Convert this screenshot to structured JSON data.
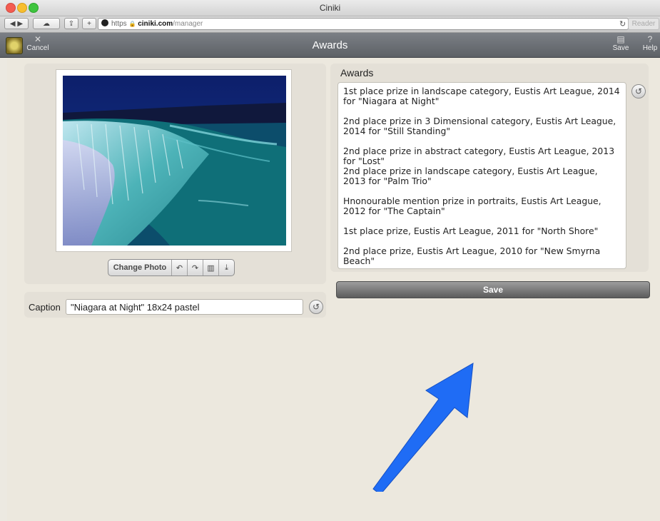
{
  "window": {
    "title": "Ciniki"
  },
  "browser": {
    "url_scheme": "https",
    "url_host": "ciniki.com",
    "url_path": "/manager",
    "reload_icon": "reload-icon",
    "reader_label": "Reader"
  },
  "header": {
    "title": "Awards",
    "cancel_label": "Cancel",
    "save_label": "Save",
    "help_label": "Help"
  },
  "photo": {
    "change_label": "Change Photo",
    "icons": [
      "rotate-left-icon",
      "rotate-right-icon",
      "trash-icon",
      "download-icon"
    ]
  },
  "caption": {
    "label": "Caption",
    "value": "\"Niagara at Night\" 18x24 pastel"
  },
  "awards": {
    "label": "Awards",
    "text": "1st place prize in landscape category, Eustis Art League, 2014 for \"Niagara at Night\"\n\n2nd place prize in 3 Dimensional category, Eustis Art League, 2014 for \"Still Standing\"\n\n2nd place prize in abstract category, Eustis Art League, 2013 for \"Lost\"\n2nd place prize in landscape category, Eustis Art League, 2013 for \"Palm Trio\"\n\nHnonourable mention prize in portraits, Eustis Art League, 2012 for \"The Captain\"\n\n1st place prize, Eustis Art League, 2011 for \"North Shore\"\n\n2nd place prize, Eustis Art League, 2010 for \"New Smyrna Beach\""
  },
  "save_button": {
    "label": "Save"
  },
  "colors": {
    "accent_arrow": "#1f6cf5",
    "header_bg": "#6b6f75"
  }
}
